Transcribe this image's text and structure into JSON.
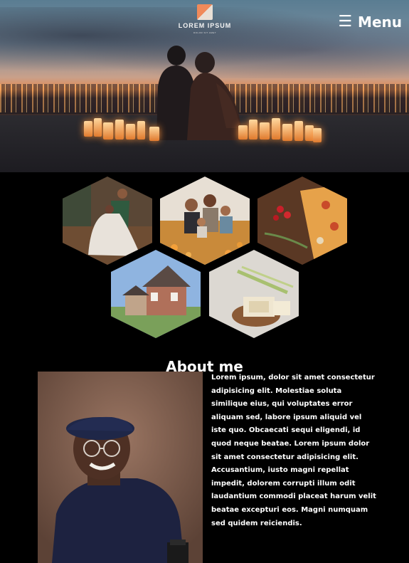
{
  "header": {
    "logo_title": "LOREM IPSUM",
    "logo_tagline": "DOLOR SIT AMET",
    "menu_icon": "hamburger-icon",
    "menu_label": "Menu"
  },
  "gallery": {
    "items": [
      {
        "name": "wedding-dance-photo"
      },
      {
        "name": "family-field-photo"
      },
      {
        "name": "pizza-photo"
      },
      {
        "name": "house-photo"
      },
      {
        "name": "soap-bar-photo"
      }
    ]
  },
  "about": {
    "title": "About me",
    "body": "Lorem ipsum, dolor sit amet consectetur adipisicing elit. Molestiae soluta similique eius, qui voluptates error aliquam sed, labore ipsum aliquid vel iste quo. Obcaecati sequi eligendi, id quod neque beatae. Lorem ipsum dolor sit amet consectetur adipisicing elit. Accusantium, iusto magni repellat impedit, dolorem corrupti illum odit laudantium commodi placeat harum velit beatae excepturi eos. Magni numquam sed quidem reiciendis."
  },
  "colors": {
    "background": "#000000",
    "text": "#ffffff",
    "logo_accent": "#f08a5a"
  }
}
